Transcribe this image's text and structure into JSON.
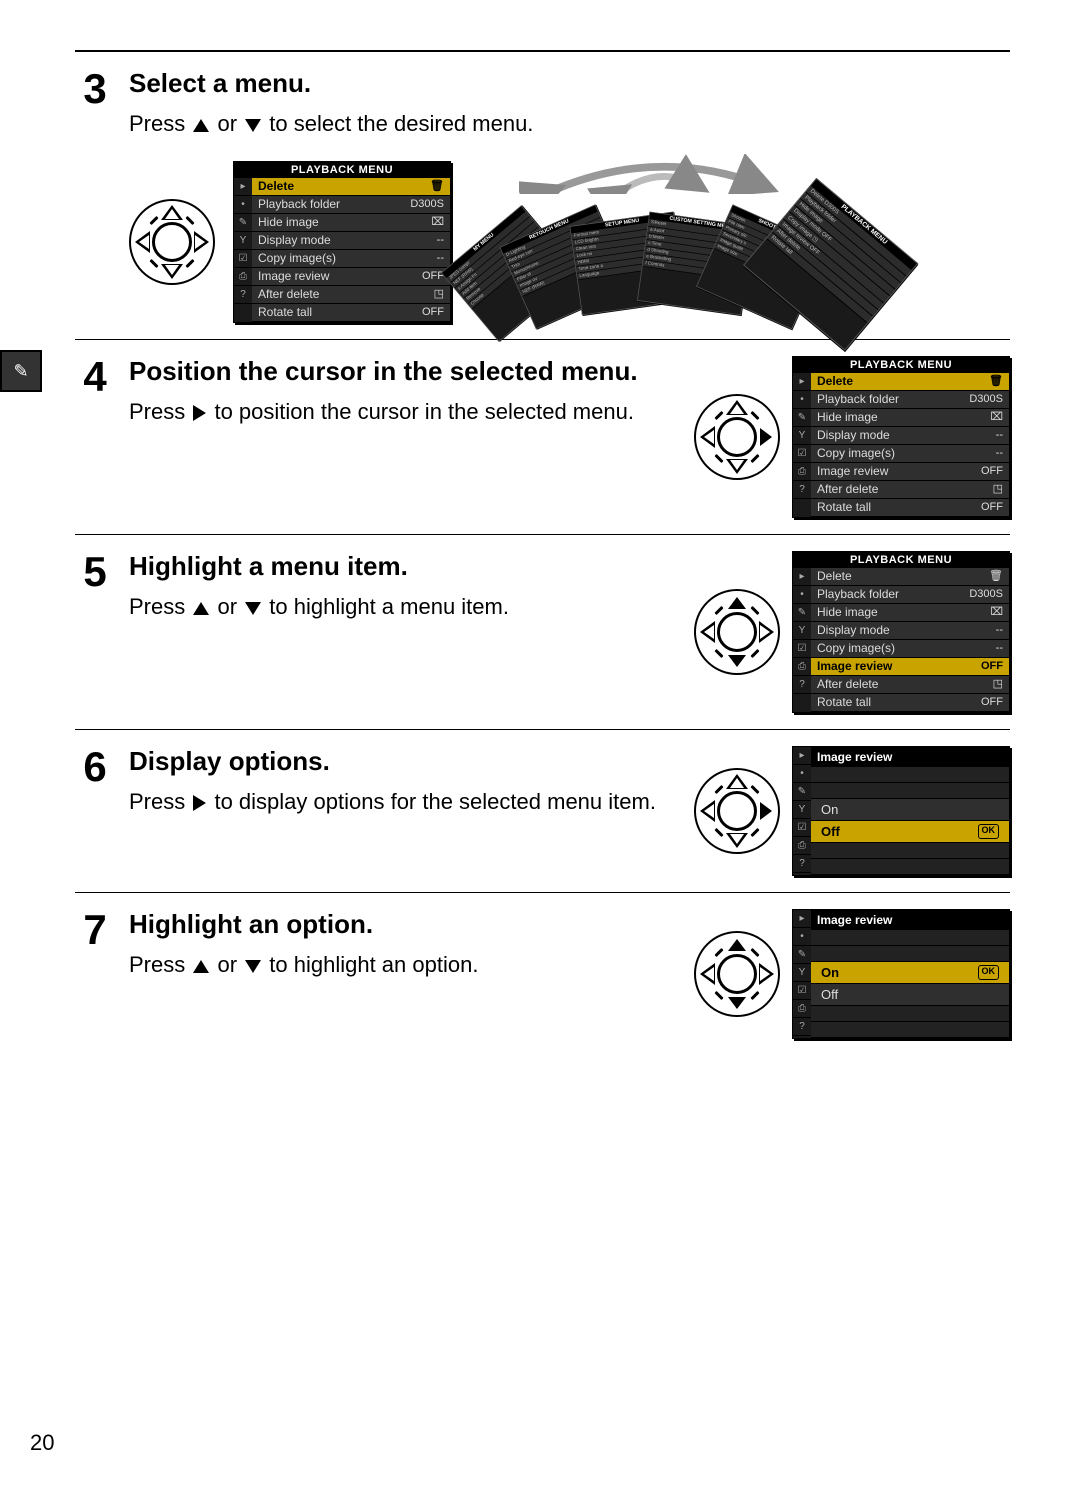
{
  "page_number": "20",
  "margin_tab_icon": "leaf-icon",
  "steps": [
    {
      "number": "3",
      "title": "Select a menu.",
      "text_pre": "Press ",
      "text_mid": " or ",
      "text_post": " to select the desired menu.",
      "dpad_mode": "updown-hollow",
      "playback_menu": {
        "title": "PLAYBACK MENU",
        "tabs": [
          "▸",
          "•",
          "✎",
          "Y",
          "☑",
          "⎙",
          "?"
        ],
        "rows": [
          {
            "label": "Delete",
            "value": "🗑",
            "selected": true
          },
          {
            "label": "Playback folder",
            "value": "D300S"
          },
          {
            "label": "Hide image",
            "value": "⌧"
          },
          {
            "label": "Display mode",
            "value": "--"
          },
          {
            "label": "Copy image(s)",
            "value": "--"
          },
          {
            "label": "Image review",
            "value": "OFF"
          },
          {
            "label": "After delete",
            "value": "◳"
          },
          {
            "label": "Rotate tall",
            "value": "OFF"
          }
        ]
      },
      "fan_cards": [
        {
          "title": "MY MENU",
          "lines": [
            "JPEG compr",
            "NEF (RAW)",
            "s:Assign Fn",
            "Add item",
            "Remove",
            "Choose"
          ]
        },
        {
          "title": "RETOUCH MENU",
          "lines": [
            "D-Lighting",
            "Red-eye corr",
            "Trim",
            "Monochrome",
            "Filter ef",
            "Image ov",
            "NEF (RAW)"
          ]
        },
        {
          "title": "SETUP MENU",
          "lines": [
            "Format mem",
            "LCD brightn",
            "Clean ima",
            "Lock mi",
            "HDMI",
            "Time zone a",
            "Language"
          ]
        },
        {
          "title": "CUSTOM SETTING MENU",
          "lines": [
            "⎘Reset",
            "a:Autof",
            "b:Meter",
            "c:Time",
            "d Shooting",
            "e Bracketing",
            "f Controls"
          ]
        },
        {
          "title": "SHOOTING MENU",
          "lines": [
            "Shootin",
            "File nam",
            "Primary slo",
            "Secondary s",
            "Image qualit",
            "Image size"
          ]
        },
        {
          "title": "PLAYBACK MENU",
          "lines": [
            "Delete   D300S",
            "Playback folder",
            "Hide image",
            "Display mode  OFF",
            "Copy image   ◳",
            "Image review  OFF",
            "After delete",
            "Rotate tall"
          ]
        }
      ]
    },
    {
      "number": "4",
      "title": "Position the cursor in the selected menu.",
      "text_pre": "Press ",
      "text_post": " to position the cursor in the selected menu.",
      "dpad_mode": "right-solid",
      "playback_menu": {
        "title": "PLAYBACK MENU",
        "tabs": [
          "▸",
          "•",
          "✎",
          "Y",
          "☑",
          "⎙",
          "?"
        ],
        "rows": [
          {
            "label": "Delete",
            "value": "🗑",
            "selected": true
          },
          {
            "label": "Playback folder",
            "value": "D300S"
          },
          {
            "label": "Hide image",
            "value": "⌧"
          },
          {
            "label": "Display mode",
            "value": "--"
          },
          {
            "label": "Copy image(s)",
            "value": "--"
          },
          {
            "label": "Image review",
            "value": "OFF"
          },
          {
            "label": "After delete",
            "value": "◳"
          },
          {
            "label": "Rotate tall",
            "value": "OFF"
          }
        ]
      }
    },
    {
      "number": "5",
      "title": "Highlight a menu item.",
      "text_pre": "Press ",
      "text_mid": " or ",
      "text_post": " to highlight a menu item.",
      "dpad_mode": "updown-solid",
      "playback_menu": {
        "title": "PLAYBACK MENU",
        "tabs": [
          "▸",
          "•",
          "✎",
          "Y",
          "☑",
          "⎙",
          "?"
        ],
        "rows": [
          {
            "label": "Delete",
            "value": "🗑"
          },
          {
            "label": "Playback folder",
            "value": "D300S"
          },
          {
            "label": "Hide image",
            "value": "⌧"
          },
          {
            "label": "Display mode",
            "value": "--"
          },
          {
            "label": "Copy image(s)",
            "value": "--"
          },
          {
            "label": "Image review",
            "value": "OFF",
            "selected": true
          },
          {
            "label": "After delete",
            "value": "◳"
          },
          {
            "label": "Rotate tall",
            "value": "OFF"
          }
        ]
      }
    },
    {
      "number": "6",
      "title": "Display options.",
      "text_pre": "Press ",
      "text_post": " to display options for the selected menu item.",
      "dpad_mode": "right-solid",
      "option_menu": {
        "header": "Image review",
        "tabs": [
          "▸",
          "•",
          "✎",
          "Y",
          "☑",
          "⎙",
          "?"
        ],
        "options": [
          {
            "label": "On"
          },
          {
            "label": "Off",
            "selected": true,
            "ok": true
          }
        ]
      }
    },
    {
      "number": "7",
      "title": "Highlight an option.",
      "text_pre": "Press ",
      "text_mid": " or ",
      "text_post": " to highlight an option.",
      "dpad_mode": "updown-solid",
      "option_menu": {
        "header": "Image review",
        "tabs": [
          "▸",
          "•",
          "✎",
          "Y",
          "☑",
          "⎙",
          "?"
        ],
        "options": [
          {
            "label": "On",
            "selected": true,
            "ok": true
          },
          {
            "label": "Off"
          }
        ]
      }
    }
  ]
}
